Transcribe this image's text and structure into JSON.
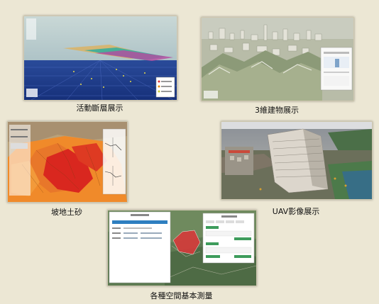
{
  "panels": [
    {
      "caption": "活動斷層展示"
    },
    {
      "caption": "3維建物展示"
    },
    {
      "caption": "坡地土砂"
    },
    {
      "caption": "UAV影像展示"
    },
    {
      "caption": "各種空間基本測量"
    }
  ],
  "colors": {
    "background": "#ece7d4",
    "fault_sea": "#1f3f8e",
    "landslide_orange": "#f08a2a",
    "landslide_red": "#d9271f",
    "measure_polygon": "#d63a3a",
    "dialog_button_green": "#3e9c5c"
  }
}
